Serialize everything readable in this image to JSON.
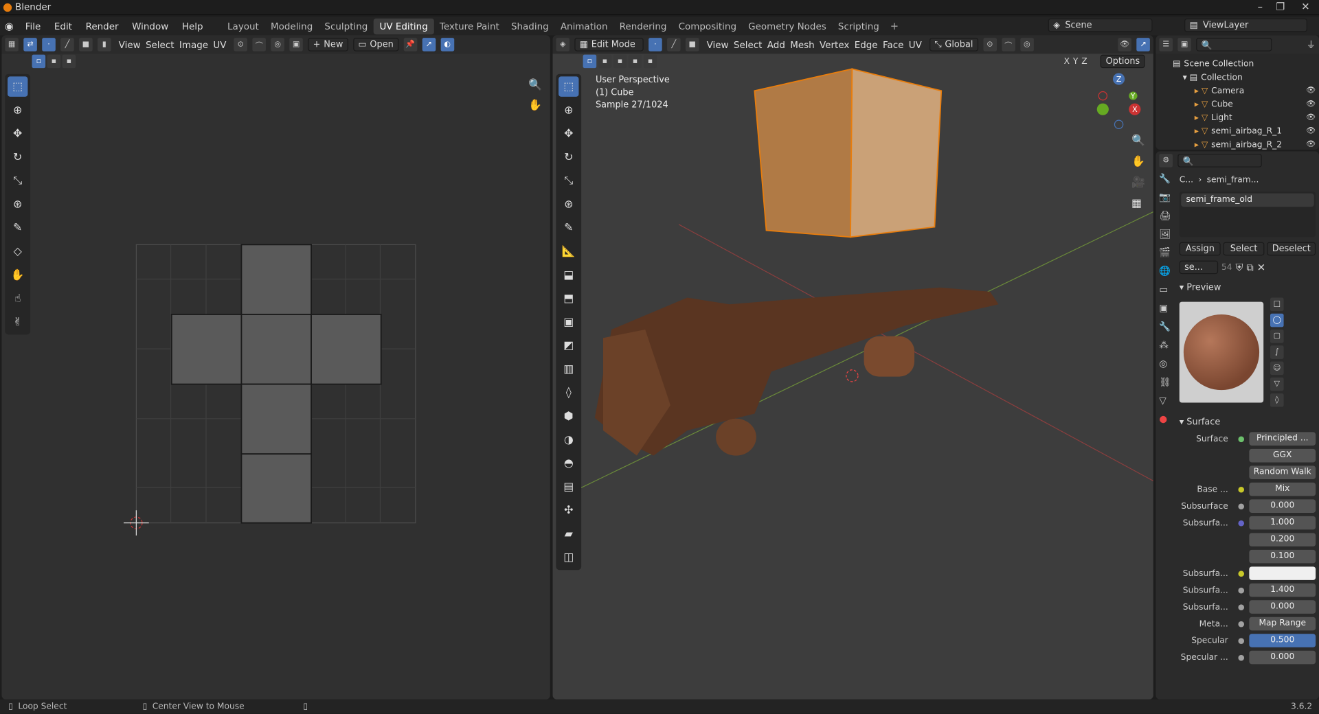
{
  "app": {
    "title": "Blender",
    "version": "3.6.2"
  },
  "menus": [
    "File",
    "Edit",
    "Render",
    "Window",
    "Help"
  ],
  "workspaces": [
    "Layout",
    "Modeling",
    "Sculpting",
    "UV Editing",
    "Texture Paint",
    "Shading",
    "Animation",
    "Rendering",
    "Compositing",
    "Geometry Nodes",
    "Scripting"
  ],
  "active_workspace": "UV Editing",
  "scene": "Scene",
  "view_layer": "ViewLayer",
  "uv_editor": {
    "menus": [
      "View",
      "Select",
      "Image",
      "UV"
    ],
    "new_label": "New",
    "open_label": "Open"
  },
  "viewport": {
    "mode": "Edit Mode",
    "menus": [
      "View",
      "Select",
      "Add",
      "Mesh",
      "Vertex",
      "Edge",
      "Face",
      "UV"
    ],
    "orientation": "Global",
    "options_label": "Options",
    "overlay_lines": [
      "User Perspective",
      "(1) Cube",
      "Sample 27/1024"
    ],
    "axes": [
      "X",
      "Y",
      "Z"
    ]
  },
  "outliner": {
    "root": "Scene Collection",
    "collection": "Collection",
    "items": [
      "Camera",
      "Cube",
      "Light",
      "semi_airbag_R_1",
      "semi_airbag_R_2"
    ]
  },
  "properties": {
    "breadcrumb_obj": "C...",
    "breadcrumb_mat": "semi_fram...",
    "material_slot": "semi_frame_old",
    "assign": "Assign",
    "select": "Select",
    "deselect": "Deselect",
    "mat_short": "se...",
    "users": "54",
    "preview_title": "Preview",
    "surface_title": "Surface",
    "rows": [
      {
        "label": "Surface",
        "value": "Principled ...",
        "dot": "#6cc06c"
      },
      {
        "label": "",
        "value": "GGX",
        "dot": ""
      },
      {
        "label": "",
        "value": "Random Walk",
        "dot": ""
      },
      {
        "label": "Base ...",
        "value": "Mix",
        "dot": "#c8c829"
      },
      {
        "label": "Subsurface",
        "value": "0.000",
        "dot": "#a1a1a1"
      },
      {
        "label": "Subsurfa...",
        "value": "1.000",
        "dot": "#6363c7"
      },
      {
        "label": "",
        "value": "0.200",
        "dot": ""
      },
      {
        "label": "",
        "value": "0.100",
        "dot": ""
      },
      {
        "label": "Subsurfa...",
        "value": "",
        "dot": "#c8c829"
      },
      {
        "label": "Subsurfa...",
        "value": "1.400",
        "dot": "#a1a1a1"
      },
      {
        "label": "Subsurfa...",
        "value": "0.000",
        "dot": "#a1a1a1"
      },
      {
        "label": "Meta...",
        "value": "Map Range",
        "dot": "#a1a1a1"
      },
      {
        "label": "Specular",
        "value": "0.500",
        "dot": "#a1a1a1"
      },
      {
        "label": "Specular ...",
        "value": "0.000",
        "dot": "#a1a1a1"
      }
    ]
  },
  "status": {
    "left": "Loop Select",
    "middle": "Center View to Mouse"
  },
  "colors": {
    "accent": "#4772b3",
    "selection": "#e87d0d"
  }
}
